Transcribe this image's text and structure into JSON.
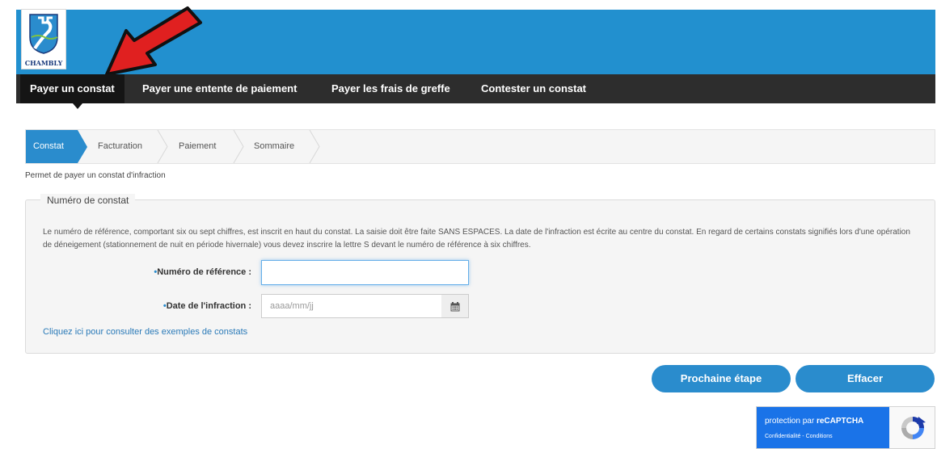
{
  "header": {
    "logo_text": "CHAMBLY"
  },
  "nav": {
    "items": [
      {
        "label": "Payer un constat"
      },
      {
        "label": "Payer une entente de paiement"
      },
      {
        "label": "Payer les frais de greffe"
      },
      {
        "label": "Contester un constat"
      }
    ]
  },
  "steps": {
    "items": [
      {
        "label": "Constat"
      },
      {
        "label": "Facturation"
      },
      {
        "label": "Paiement"
      },
      {
        "label": "Sommaire"
      }
    ]
  },
  "intro": "Permet de payer un constat d'infraction",
  "form": {
    "legend": "Numéro de constat",
    "description": "Le numéro de référence, comportant six ou sept chiffres, est inscrit en haut du constat. La saisie doit être faite SANS ESPACES. La date de l'infraction est écrite au centre du constat. En regard de certains constats signifiés lors d'une opération de déneigement (stationnement de nuit en période hivernale) vous devez inscrire la lettre S devant le numéro de référence à six chiffres.",
    "reference_label": "Numéro de référence :",
    "reference_value": "",
    "date_label": "Date de l'infraction :",
    "date_placeholder": "aaaa/mm/jj",
    "required_mark": "•",
    "examples_link": "Cliquez ici pour consulter des exemples de constats"
  },
  "buttons": {
    "next": "Prochaine étape",
    "clear": "Effacer"
  },
  "recaptcha": {
    "title_prefix": "protection par ",
    "title_brand": "reCAPTCHA",
    "links": "Confidentialité - Conditions"
  },
  "colors": {
    "accent": "#2a8ccd",
    "banner": "#2290cf",
    "nav_bg": "#2d2d2d",
    "annotation_arrow": "#e02020"
  }
}
